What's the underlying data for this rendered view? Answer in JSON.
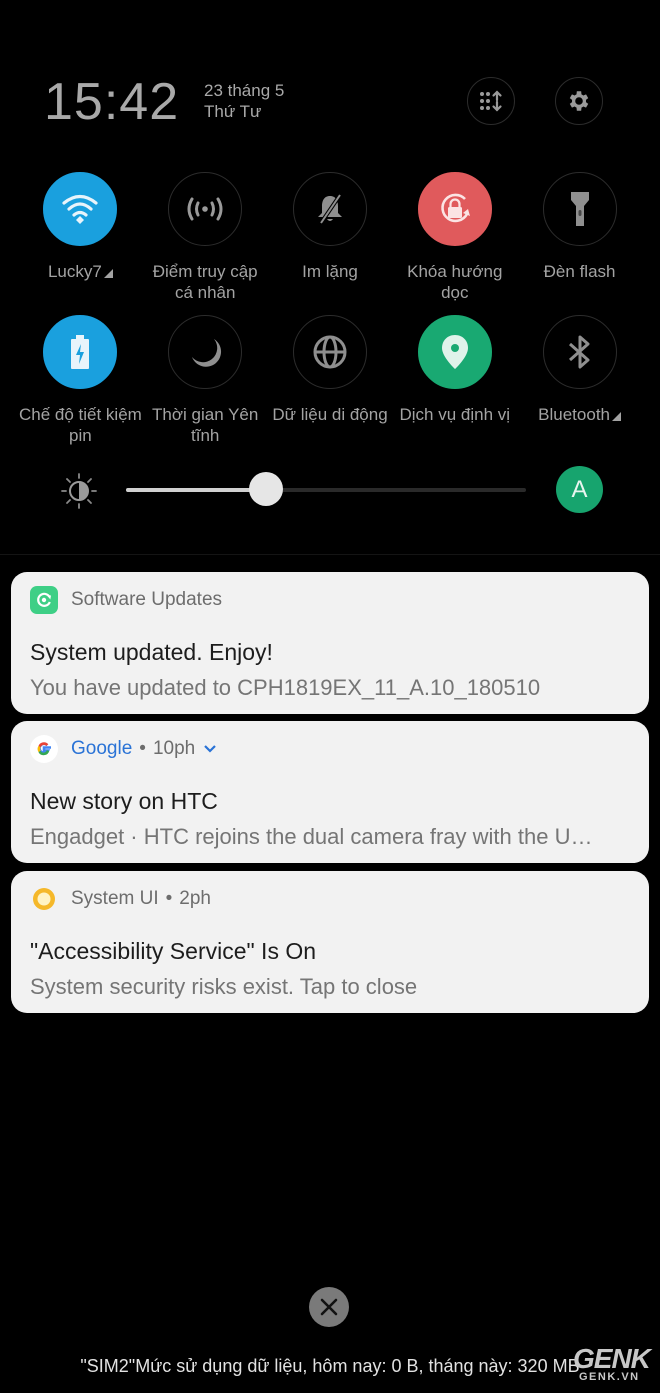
{
  "header": {
    "time": "15:42",
    "date_line1": "23 tháng 5",
    "date_line2": "Thứ Tư",
    "edit_tiles_icon": "grid-sort-icon",
    "settings_icon": "gear-icon"
  },
  "tiles": [
    {
      "label": "Lucky7",
      "icon": "wifi-icon",
      "state": "on",
      "color": "#1aa0de",
      "has_dropdown": true
    },
    {
      "label": "Điểm truy cập cá nhân",
      "icon": "hotspot-icon",
      "state": "off",
      "has_dropdown": false
    },
    {
      "label": "Im lặng",
      "icon": "bell-off-icon",
      "state": "off",
      "has_dropdown": false
    },
    {
      "label": "Khóa hướng dọc",
      "icon": "rotation-lock-icon",
      "state": "on",
      "color": "#e05a5c",
      "has_dropdown": false
    },
    {
      "label": "Đèn flash",
      "icon": "flashlight-icon",
      "state": "off",
      "has_dropdown": false
    },
    {
      "label": "Chế độ tiết kiệm pin",
      "icon": "battery-saver-icon",
      "state": "on",
      "color": "#1aa0de",
      "has_dropdown": false
    },
    {
      "label": "Thời gian Yên tĩnh",
      "icon": "moon-icon",
      "state": "off",
      "has_dropdown": false
    },
    {
      "label": "Dữ liệu di động",
      "icon": "globe-icon",
      "state": "off",
      "has_dropdown": false
    },
    {
      "label": "Dịch vụ định vị",
      "icon": "location-pin-icon",
      "state": "on",
      "color": "#19a972",
      "has_dropdown": false
    },
    {
      "label": "Bluetooth",
      "icon": "bluetooth-icon",
      "state": "off",
      "has_dropdown": true
    }
  ],
  "brightness": {
    "level_percent": 35,
    "auto_label": "A",
    "auto_color": "#17a46e"
  },
  "notifications": [
    {
      "app": "Software Updates",
      "time": "",
      "title": "System updated. Enjoy!",
      "body": "You have updated to CPH1819EX_11_A.10_180510",
      "icon": "software-update-icon",
      "icon_color": "#3ecf86"
    },
    {
      "app": "Google",
      "time": "10ph",
      "title": "New story on HTC",
      "body": "Engadget · HTC rejoins the dual camera fray with the U…",
      "icon": "google-g-icon",
      "app_color": "#2a73d6",
      "expandable": true
    },
    {
      "app": "System UI",
      "time": "2ph",
      "title": "\"Accessibility Service\" Is On",
      "body": "System security risks exist. Tap to close",
      "icon": "system-ui-ring-icon",
      "icon_color": "#f5b82a"
    }
  ],
  "footer": {
    "clear_all_icon": "close-icon",
    "usage_text": "\"SIM2\"Mức sử dụng dữ liệu, hôm nay: 0 B, tháng này: 320 MB",
    "watermark_big": "GENK",
    "watermark_small": "GENK.VN"
  }
}
